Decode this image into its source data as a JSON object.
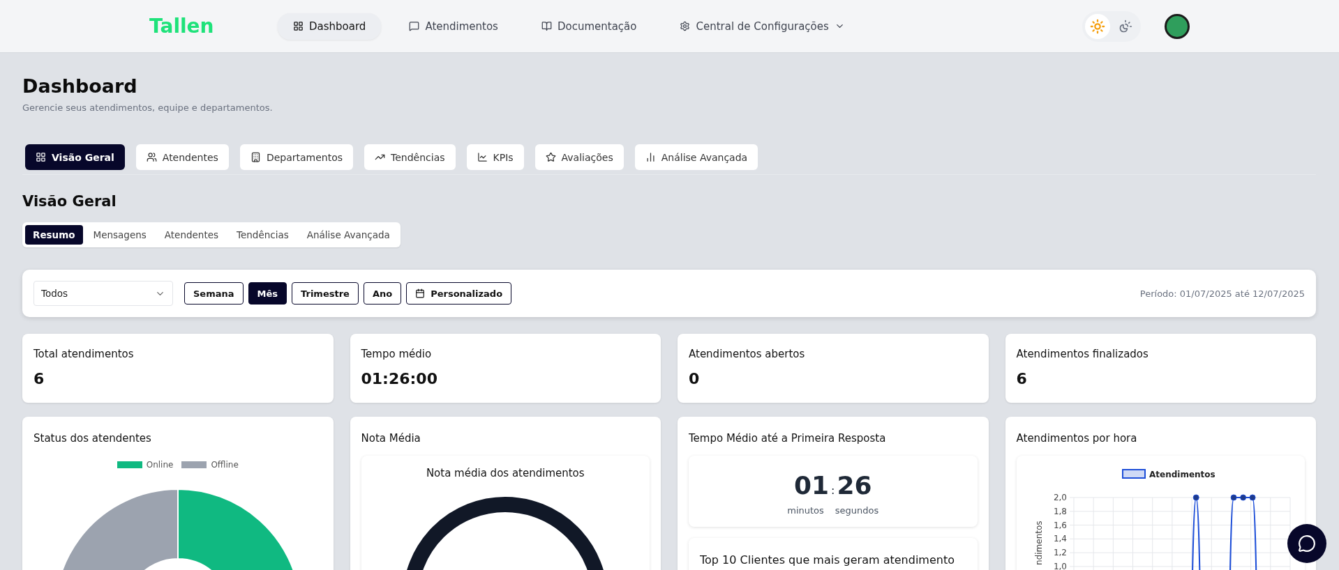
{
  "header": {
    "logo": "Tallen",
    "nav": [
      {
        "label": "Dashboard",
        "selected": true,
        "has_menu": false
      },
      {
        "label": "Atendimentos",
        "selected": false,
        "has_menu": false
      },
      {
        "label": "Documentação",
        "selected": false,
        "has_menu": false
      },
      {
        "label": "Central de Configurações",
        "selected": false,
        "has_menu": true
      }
    ],
    "theme_toggle": [
      {
        "selected": true
      },
      {
        "selected": false
      }
    ]
  },
  "page": {
    "title": "Dashboard",
    "subtitle": "Gerencie seus atendimentos, equipe e departamentos."
  },
  "tabs": [
    {
      "label": "Visão Geral",
      "selected": true
    },
    {
      "label": "Atendentes",
      "selected": false
    },
    {
      "label": "Departamentos",
      "selected": false
    },
    {
      "label": "Tendências",
      "selected": false
    },
    {
      "label": "KPIs",
      "selected": false
    },
    {
      "label": "Avaliações",
      "selected": false
    },
    {
      "label": "Análise Avançada",
      "selected": false
    }
  ],
  "section": {
    "title": "Visão Geral",
    "subtabs": [
      {
        "label": "Resumo",
        "selected": true
      },
      {
        "label": "Mensagens",
        "selected": false
      },
      {
        "label": "Atendentes",
        "selected": false
      },
      {
        "label": "Tendências",
        "selected": false
      },
      {
        "label": "Análise Avançada",
        "selected": false
      }
    ]
  },
  "filters": {
    "department": {
      "value": "Todos"
    },
    "periods": [
      {
        "label": "Semana",
        "selected": false,
        "kind": "preset"
      },
      {
        "label": "Mês",
        "selected": true,
        "kind": "preset"
      },
      {
        "label": "Trimestre",
        "selected": false,
        "kind": "preset"
      },
      {
        "label": "Ano",
        "selected": false,
        "kind": "preset"
      },
      {
        "label": "Personalizado",
        "selected": false,
        "kind": "custom"
      }
    ],
    "period_text": "Período: 01/07/2025 até 12/07/2025"
  },
  "kpis": [
    {
      "label": "Total atendimentos",
      "value": "6"
    },
    {
      "label": "Tempo médio",
      "value": "01:26:00"
    },
    {
      "label": "Atendimentos abertos",
      "value": "0"
    },
    {
      "label": "Atendimentos finalizados",
      "value": "6"
    }
  ],
  "status_panel": {
    "title": "Status dos atendentes",
    "legend": [
      {
        "label": "Online",
        "color": "#10b981"
      },
      {
        "label": "Offline",
        "color": "#9ca3af"
      }
    ]
  },
  "rating_panel": {
    "title": "Nota Média",
    "subtitle": "Nota média dos atendimentos"
  },
  "response_panel": {
    "title": "Tempo Médio até a Primeira Resposta",
    "minutes": "01",
    "separator": ":",
    "seconds": "26",
    "minutes_label": "minutos",
    "seconds_label": "segundos",
    "clients_title": "Top 10 Clientes que mais geram atendimento"
  },
  "hourly_panel": {
    "title": "Atendimentos por hora",
    "chart_data": {
      "type": "line",
      "ylabel": "ndimentos",
      "grid": true,
      "ylim": [
        1,
        2
      ],
      "yticks": [
        {
          "value": 1,
          "label": "1,0"
        },
        {
          "value": 1.2,
          "label": "1,2"
        },
        {
          "value": 1.4,
          "label": "1,4"
        },
        {
          "value": 1.6,
          "label": "1,6"
        },
        {
          "value": 1.8,
          "label": "1,8"
        },
        {
          "value": 2,
          "label": "2,0"
        }
      ],
      "series": [
        {
          "name": "Atendimentos",
          "color": "#1d4ed8",
          "marker": "circle",
          "values": [
            null,
            null,
            null,
            null,
            null,
            null,
            null,
            null,
            null,
            null,
            null,
            null,
            null,
            2,
            null,
            null,
            null,
            2,
            2,
            2,
            null,
            null,
            null,
            null
          ]
        }
      ]
    }
  },
  "chat_button": {
    "visible": true
  }
}
